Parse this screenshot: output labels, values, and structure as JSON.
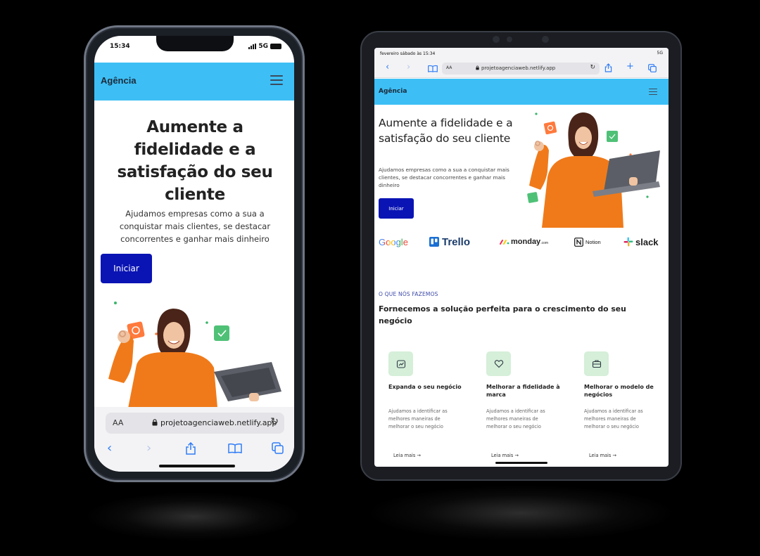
{
  "phone": {
    "status": {
      "time": "15:34",
      "network": "5G"
    },
    "header": {
      "brand": "Agência"
    },
    "hero": {
      "title": "Aumente a fidelidade e a satisfação do seu cliente",
      "subtitle": "Ajudamos empresas como a sua a conquistar mais clientes, se destacar concorrentes e ganhar mais dinheiro",
      "cta": "Iniciar"
    },
    "browser": {
      "text_size": "AA",
      "url": "projetoagenciaweb.netlify.app"
    }
  },
  "tablet": {
    "status": {
      "datetime": "fevereiro sábado às 15:34",
      "network": "5G"
    },
    "browser": {
      "text_size": "AA",
      "url": "projetoagenciaweb.netlify.app"
    },
    "header": {
      "brand": "Agência"
    },
    "hero": {
      "title": "Aumente a fidelidade e a satisfação do seu cliente",
      "subtitle": "Ajudamos empresas como a sua a conquistar mais clientes, se destacar concorrentes e ganhar mais dinheiro",
      "cta": "Iniciar"
    },
    "logos": {
      "google": "Google",
      "trello": "Trello",
      "monday": "monday",
      "monday_suffix": ".com",
      "notion": "Notion",
      "slack": "slack"
    },
    "services": {
      "eyebrow": "O QUE NÓS FAZEMOS",
      "heading": "Fornecemos a solução perfeita para o crescimento do seu negócio",
      "items": [
        {
          "title": "Expanda o seu negócio",
          "desc": "Ajudamos a identificar as melhores maneiras de melhorar o seu negócio",
          "link": "Leia mais →"
        },
        {
          "title": "Melhorar a fidelidade à marca",
          "desc": "Ajudamos a identificar as melhores maneiras de melhorar o seu negócio",
          "link": "Leia mais →"
        },
        {
          "title": "Melhorar o modelo de negócios",
          "desc": "Ajudamos a identificar as melhores maneiras de melhorar o seu negócio",
          "link": "Leia mais →"
        }
      ]
    }
  },
  "colors": {
    "header": "#3dbff5",
    "cta": "#0a14b4",
    "eyebrow": "#3b49a8",
    "feature_icon_bg": "#d5efd9",
    "safari_blue": "#2f7cf6"
  },
  "icons": [
    "hamburger-icon",
    "lock-icon",
    "reload-icon",
    "back-icon",
    "forward-icon",
    "share-icon",
    "bookmarks-icon",
    "tabs-icon",
    "plus-icon"
  ]
}
